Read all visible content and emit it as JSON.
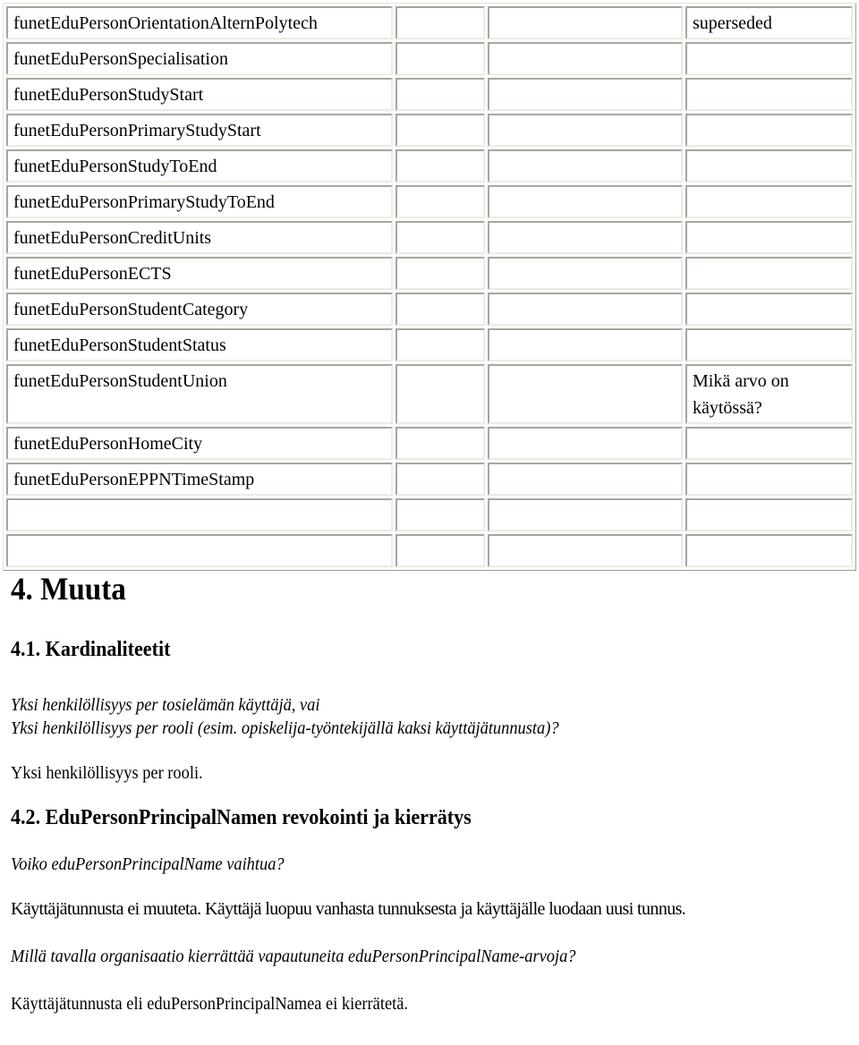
{
  "table": {
    "rows": [
      {
        "name": "funetEduPersonOrientationAlternPolytech",
        "col2": "",
        "col3": "",
        "note": "superseded"
      },
      {
        "name": "funetEduPersonSpecialisation",
        "col2": "",
        "col3": "",
        "note": ""
      },
      {
        "name": "funetEduPersonStudyStart",
        "col2": "",
        "col3": "",
        "note": ""
      },
      {
        "name": "funetEduPersonPrimaryStudyStart",
        "col2": "",
        "col3": "",
        "note": ""
      },
      {
        "name": "funetEduPersonStudyToEnd",
        "col2": "",
        "col3": "",
        "note": ""
      },
      {
        "name": "funetEduPersonPrimaryStudyToEnd",
        "col2": "",
        "col3": "",
        "note": ""
      },
      {
        "name": "funetEduPersonCreditUnits",
        "col2": "",
        "col3": "",
        "note": ""
      },
      {
        "name": "funetEduPersonECTS",
        "col2": "",
        "col3": "",
        "note": ""
      },
      {
        "name": "funetEduPersonStudentCategory",
        "col2": "",
        "col3": "",
        "note": ""
      },
      {
        "name": "funetEduPersonStudentStatus",
        "col2": "",
        "col3": "",
        "note": ""
      },
      {
        "name": "funetEduPersonStudentUnion",
        "col2": "",
        "col3": "",
        "note": "Mikä arvo on käytössä?"
      },
      {
        "name": "funetEduPersonHomeCity",
        "col2": "",
        "col3": "",
        "note": ""
      },
      {
        "name": "funetEduPersonEPPNTimeStamp",
        "col2": "",
        "col3": "",
        "note": ""
      },
      {
        "name": "",
        "col2": "",
        "col3": "",
        "note": ""
      },
      {
        "name": "",
        "col2": "",
        "col3": "",
        "note": ""
      }
    ]
  },
  "section4": {
    "heading": "4. Muuta",
    "s41": {
      "heading": "4.1. Kardinaliteetit",
      "question_line1": "Yksi henkilöllisyys per tosielämän käyttäjä, vai",
      "question_line2": "Yksi henkilöllisyys per rooli (esim. opiskelija-työntekijällä kaksi käyttäjätunnusta)?",
      "answer": "Yksi henkilöllisyys per rooli."
    },
    "s42": {
      "heading": "4.2. EduPersonPrincipalNamen revokointi ja kierrätys",
      "question1": "Voiko eduPersonPrincipalName vaihtua?",
      "answer1": "Käyttäjätunnusta ei muuteta. Käyttäjä luopuu vanhasta tunnuksesta ja käyttäjälle luodaan uusi tunnus.",
      "question2": "Millä tavalla organisaatio kierrättää vapautuneita eduPersonPrincipalName-arvoja?",
      "answer2": "Käyttäjätunnusta eli eduPersonPrincipalNamea ei kierrätetä."
    }
  }
}
